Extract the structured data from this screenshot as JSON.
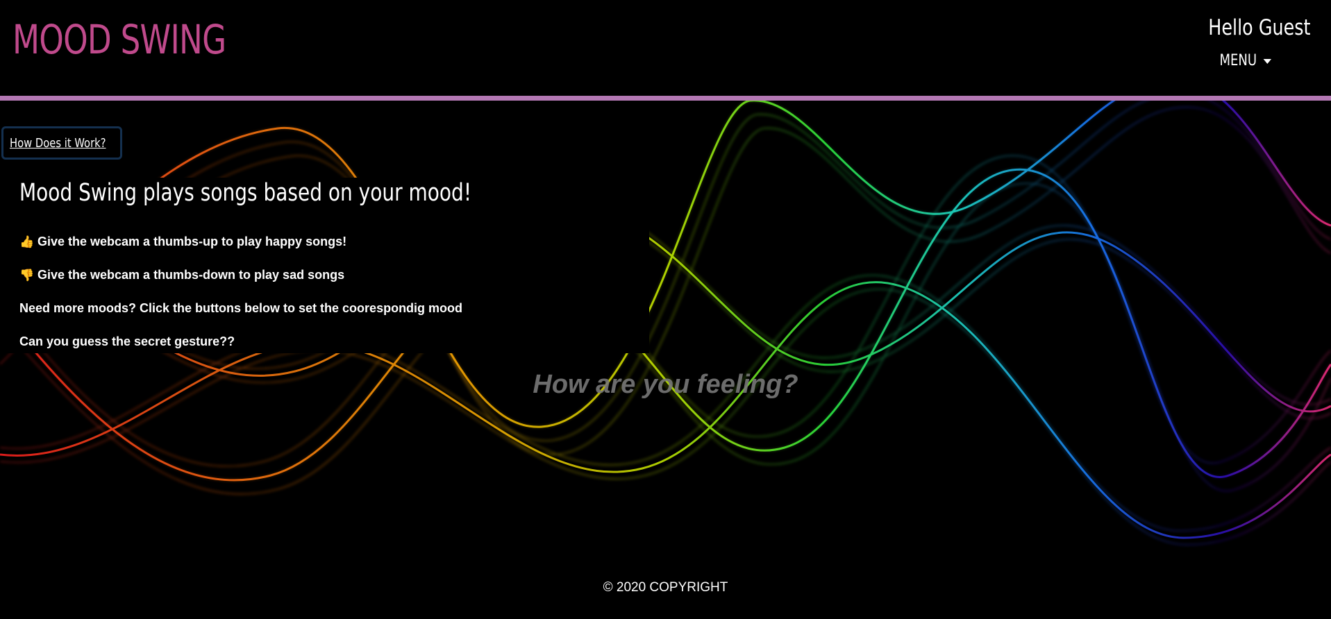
{
  "header": {
    "brand": "MOOD SWING",
    "greeting": "Hello Guest",
    "menu_label": "MENU",
    "rule_color": "#b478b4",
    "brand_color": "#c04a8c"
  },
  "how_button": {
    "label": "How Does it Work?"
  },
  "info": {
    "title": "Mood Swing plays songs based on your mood!",
    "lines": [
      {
        "icon": "thumbs-up-icon",
        "text": "Give the webcam a thumbs-up to play happy songs!"
      },
      {
        "icon": "thumbs-down-icon",
        "text": "Give the webcam a thumbs-down to play sad songs"
      },
      {
        "icon": "",
        "text": "Need more moods? Click the buttons below to set the coorespondig mood"
      },
      {
        "icon": "",
        "text": "Can you guess the secret gesture??"
      }
    ]
  },
  "prompt": "How are you feeling?",
  "footer": "© 2020 COPYRIGHT"
}
